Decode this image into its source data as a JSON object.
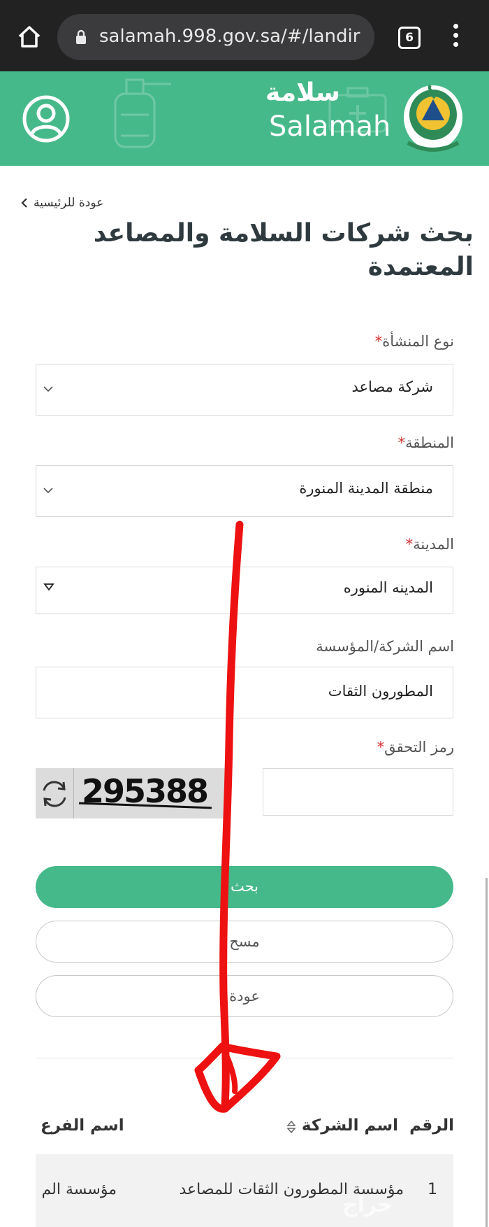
{
  "browser": {
    "url": "salamah.998.gov.sa/#/landir",
    "tab_count": "6"
  },
  "header": {
    "brand_ar": "سلامة",
    "brand_en": "Salamah"
  },
  "page": {
    "back_label": "عودة للرئيسية",
    "title": "بحث شركات السلامة والمصاعد المعتمدة"
  },
  "form": {
    "facility_type": {
      "label": "نوع المنشأة",
      "required": "*",
      "value": "شركة مصاعد"
    },
    "region": {
      "label": "المنطقة",
      "required": "*",
      "value": "منطقة المدينة المنورة"
    },
    "city": {
      "label": "المدينة",
      "required": "*",
      "value": "المدينه المنوره"
    },
    "company_name": {
      "label": "اسم الشركة/المؤسسة",
      "value": "المطورون الثقات"
    },
    "captcha": {
      "label": "رمز التحقق",
      "required": "*",
      "code": "295388",
      "value": ""
    }
  },
  "buttons": {
    "search": "بحث",
    "clear": "مسح",
    "back": "عودة"
  },
  "table": {
    "headers": {
      "number": "الرقم",
      "company": "اسم الشركة",
      "branch": "اسم الفرع"
    },
    "rows": [
      {
        "number": "1",
        "company": "مؤسسة المطورون الثقات للمصاعد",
        "branch": "مؤسسة الم"
      }
    ]
  },
  "colors": {
    "brand_green": "#46b98a",
    "annotation_red": "#ee1111",
    "required_red": "#d32f2f"
  }
}
